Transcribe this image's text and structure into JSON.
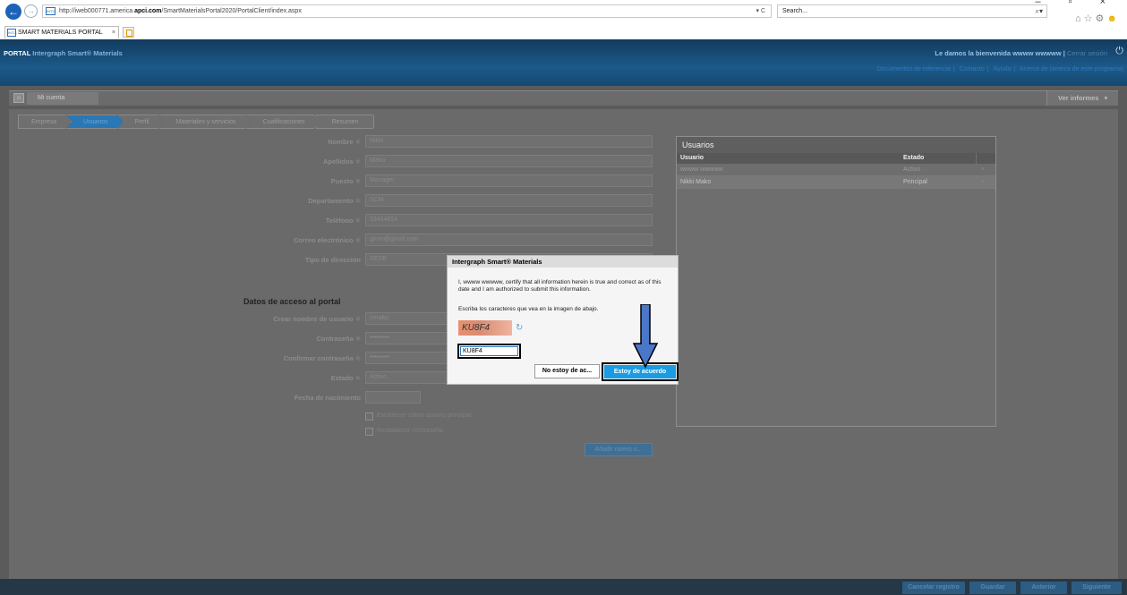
{
  "browser": {
    "url_prefix": "http://iweb000771.america.",
    "url_domain": "apci.com",
    "url_path": "/SmartMaterialsPortal2020/PortalClient/index.aspx",
    "addr_tools": "▾ C",
    "search_placeholder": "Search...",
    "tab_title": "SMART MATERIALS PORTAL",
    "favicon_text": "INTG",
    "window_controls": "–  ▫  ×"
  },
  "header": {
    "brand_prefix": "PORTAL",
    "brand_name": "Intergraph Smart® Materials",
    "welcome": "Le damos la bienvenida wwww wwwww",
    "separator": "|",
    "logout": "Cerrar sesión",
    "links": [
      "Documentos de referencia",
      "Contacto",
      "Ayuda",
      "Acerca de (acerca de este programa)"
    ]
  },
  "account_bar": {
    "tab_label": "Mi cuenta",
    "reports_label": "Ver informes"
  },
  "steps": [
    "Empresa",
    "Usuarios",
    "Perfil",
    "Materiales y servicios",
    "Cualificaciones",
    "Resumen"
  ],
  "form": {
    "fields": [
      {
        "label": "Nombre",
        "value": "Nikki"
      },
      {
        "label": "Apellidos",
        "value": "Mako"
      },
      {
        "label": "Puesto",
        "value": "Manager"
      },
      {
        "label": "Departamento",
        "value": "SCM"
      },
      {
        "label": "Teléfono",
        "value": "33434654"
      },
      {
        "label": "Correo electrónico",
        "value": "gmm@gmail.com"
      },
      {
        "label": "Tipo de dirección",
        "value": "SEDE"
      }
    ],
    "portal_section_title": "Datos de acceso al portal",
    "portal_fields": [
      {
        "label": "Crear nombre de usuario",
        "value": "nmako"
      },
      {
        "label": "Contraseña",
        "value": "•••••••••"
      },
      {
        "label": "Confirmar contraseña",
        "value": "•••••••••"
      },
      {
        "label": "Estado",
        "value": "Activo"
      },
      {
        "label": "Fecha de nacimiento",
        "value": ""
      }
    ],
    "checkbox_principal": "Establecer como usuario principal",
    "checkbox_reset": "Restablecer contraseña",
    "add_button": "Añadir nuevo u..."
  },
  "users_panel": {
    "title": "Usuarios",
    "columns": [
      "Usuario",
      "Estado"
    ],
    "rows": [
      {
        "user": "wwww wwwww",
        "state": "Activo"
      },
      {
        "user": "Nikki Mako",
        "state": "Principal"
      }
    ]
  },
  "footer": {
    "buttons": [
      "Cancelar registro",
      "Guardar",
      "Anterior",
      "Siguiente"
    ]
  },
  "modal": {
    "title": "Intergraph Smart® Materials",
    "certify_text": "I, wwww wwwww, certify that all information herein is true and correct as of this date and I am authorized to submit this information.",
    "captcha_prompt": "Escriba los caracteres que vea en la imagen de abajo.",
    "captcha_image_text": "KU8F4",
    "captcha_input_value": "KU8F4",
    "disagree_button": "No estoy de ac...",
    "agree_button": "Estoy de acuerdo"
  },
  "colors": {
    "header_blue": "#1c5a8a",
    "agree_blue": "#1a9be2",
    "overlay_gray": "#6a6a6a",
    "annotation_arrow": "#4a77c9"
  }
}
